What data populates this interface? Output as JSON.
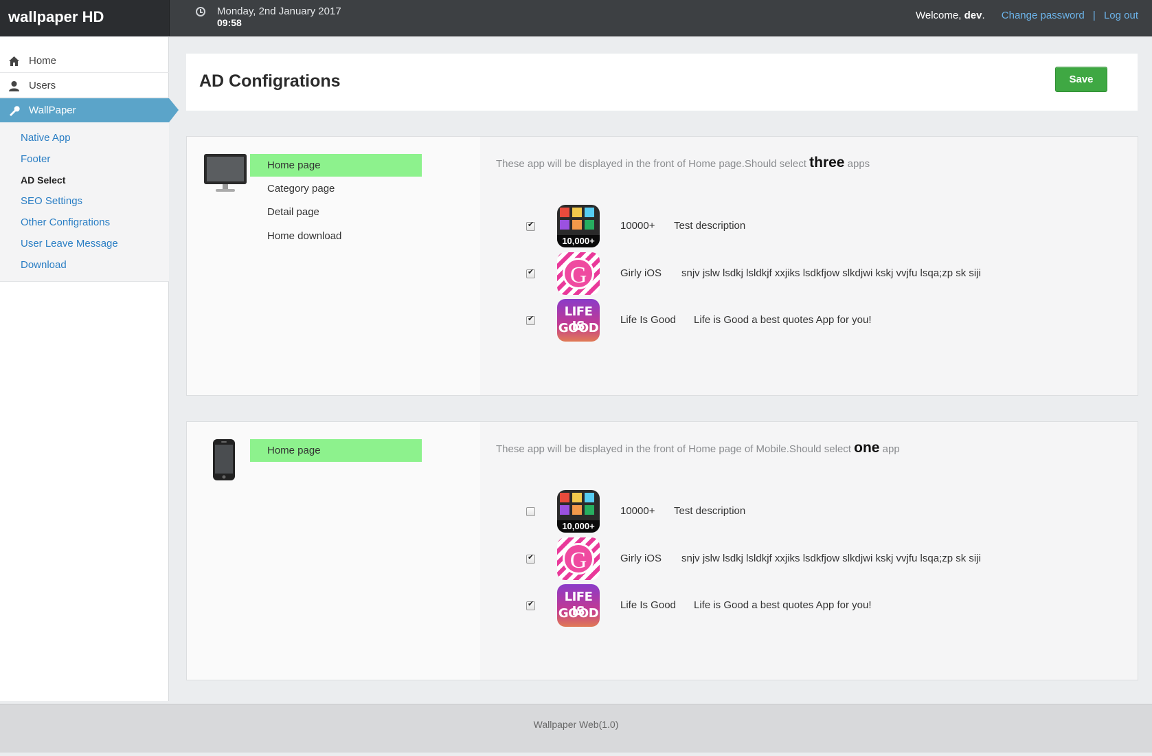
{
  "app": {
    "title": "wallpaper HD"
  },
  "header": {
    "date": "Monday, 2nd January 2017",
    "time": "09:58",
    "welcome_prefix": "Welcome,",
    "username": "dev",
    "welcome_suffix": ".",
    "change_password": "Change password",
    "separator": "|",
    "logout": "Log out"
  },
  "sidebar": {
    "items": [
      {
        "label": "Home",
        "icon": "home-icon"
      },
      {
        "label": "Users",
        "icon": "user-icon"
      },
      {
        "label": "WallPaper",
        "icon": "wrench-icon"
      }
    ],
    "subitems": [
      {
        "label": "Native App"
      },
      {
        "label": "Footer"
      },
      {
        "label": "AD Select"
      },
      {
        "label": "SEO Settings"
      },
      {
        "label": "Other Configrations"
      },
      {
        "label": "User Leave Message"
      },
      {
        "label": "Download"
      }
    ]
  },
  "main": {
    "title": "AD Configrations",
    "save_label": "Save",
    "desktop": {
      "tabs": [
        {
          "label": "Home page"
        },
        {
          "label": "Category page"
        },
        {
          "label": "Detail page"
        },
        {
          "label": "Home download"
        }
      ],
      "desc_prefix": "These app will be displayed in the front of Home page.Should select",
      "desc_count": "three",
      "desc_suffix": "apps",
      "apps": [
        {
          "checked": true,
          "name": "10000+",
          "description": "Test description",
          "icon": "10000-app-icon",
          "badge": "10,000+"
        },
        {
          "checked": true,
          "name": "Girly iOS",
          "description": "snjv jslw lsdkj lsldkjf xxjiks lsdkfjow slkdjwi kskj vvjfu lsqa;zp sk siji",
          "icon": "girly-app-icon",
          "glyph": "G"
        },
        {
          "checked": true,
          "name": "Life Is Good",
          "description": "Life is Good a best quotes App for you!",
          "icon": "life-is-good-app-icon",
          "line1": "LIFE IS",
          "line2": "GOOD"
        }
      ]
    },
    "mobile": {
      "tabs": [
        {
          "label": "Home page"
        }
      ],
      "desc_prefix": "These app will be displayed in the front of Home page of Mobile.Should select",
      "desc_count": "one",
      "desc_suffix": "app",
      "apps": [
        {
          "checked": false,
          "name": "10000+",
          "description": "Test description",
          "icon": "10000-app-icon",
          "badge": "10,000+"
        },
        {
          "checked": true,
          "name": "Girly iOS",
          "description": "snjv jslw lsdkj lsldkjf xxjiks lsdkfjow slkdjwi kskj vvjfu lsqa;zp sk siji",
          "icon": "girly-app-icon",
          "glyph": "G"
        },
        {
          "checked": true,
          "name": "Life Is Good",
          "description": "Life is Good a best quotes App for you!",
          "icon": "life-is-good-app-icon",
          "line1": "LIFE IS",
          "line2": "GOOD"
        }
      ]
    }
  },
  "footer": {
    "text": "Wallpaper Web(1.0)"
  }
}
